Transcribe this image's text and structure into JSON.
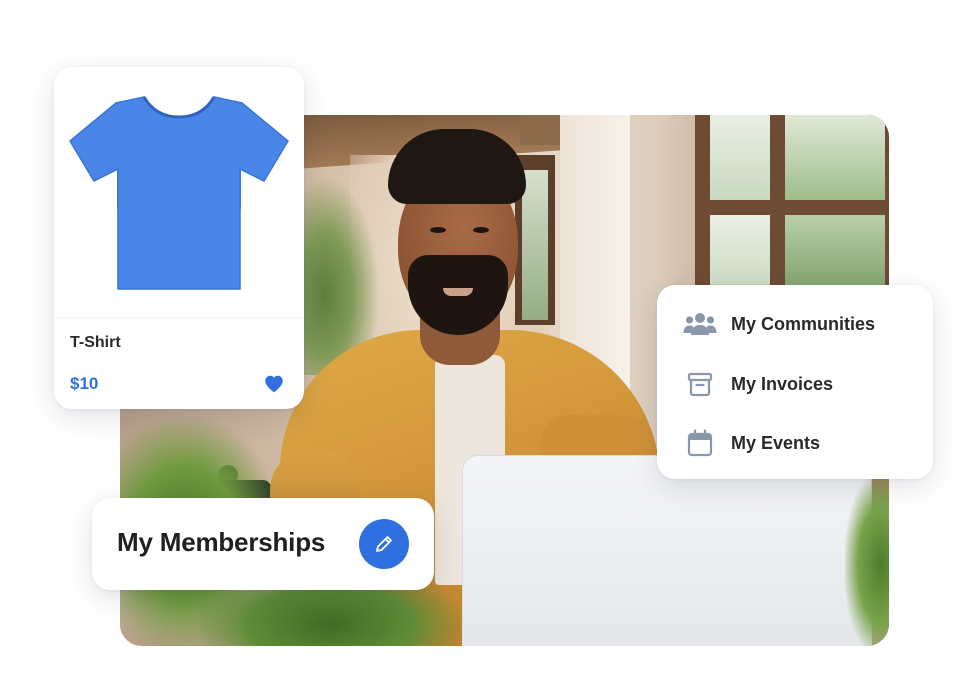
{
  "product_card": {
    "name": "T-Shirt",
    "price": "$10",
    "image_icon": "tshirt-image",
    "favorite_icon": "heart-icon",
    "accent_color": "#2f6fe0",
    "shirt_color": "#4a86e8"
  },
  "account_menu": {
    "items": [
      {
        "label": "My Communities",
        "icon": "community-icon"
      },
      {
        "label": "My Invoices",
        "icon": "archive-box-icon"
      },
      {
        "label": "My Events",
        "icon": "calendar-icon"
      }
    ],
    "icon_color": "#8a97ab"
  },
  "memberships_card": {
    "title": "My Memberships",
    "action_icon": "pencil-icon",
    "button_color": "#2f6fe0"
  }
}
